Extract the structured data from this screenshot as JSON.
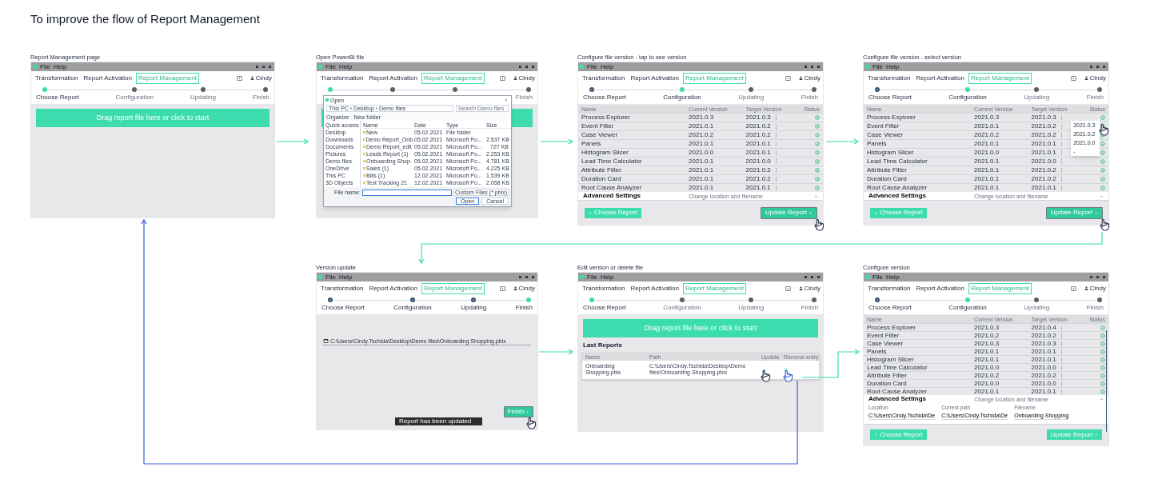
{
  "heading": "To improve the flow of Report Management",
  "screens": [
    {
      "label": "Report Management page",
      "kind": "upload",
      "menu": [
        "File",
        "Help"
      ],
      "tabs": [
        {
          "label": "Transformation",
          "selected": false
        },
        {
          "label": "Report Activation",
          "selected": false
        },
        {
          "label": "Report Management",
          "selected": true
        }
      ],
      "user": "Cindy",
      "steps": [
        {
          "label": "Choose Report",
          "done": false,
          "current": true
        },
        {
          "label": "Configuration",
          "done": false,
          "current": false
        },
        {
          "label": "Updating",
          "done": false,
          "current": false
        },
        {
          "label": "Finish",
          "done": false,
          "current": false
        }
      ],
      "drop_label": "Drag report file here or click to start"
    },
    {
      "label": "Open PowerBI file",
      "kind": "dialog",
      "menu": [
        "File",
        "Help"
      ],
      "tabs": [
        {
          "label": "Transformation",
          "selected": false
        },
        {
          "label": "Report Activation",
          "selected": false
        },
        {
          "label": "Report Management",
          "selected": true
        }
      ],
      "user": "Cindy",
      "steps": [
        {
          "done": false,
          "current": true
        },
        {
          "done": false,
          "current": false
        },
        {
          "done": false,
          "current": false
        },
        {
          "label": "Finish",
          "done": false,
          "current": false
        }
      ],
      "dialog": {
        "title": "Open",
        "address": "This PC › Desktop › Demo files",
        "search": "Search Demo files",
        "organize": "Organize",
        "new_folder": "New folder",
        "places": [
          "Quick access",
          "Desktop",
          "Downloads",
          "Documents",
          "Pictures",
          "Demo files",
          "OneDrive",
          "This PC",
          "3D Objects"
        ],
        "columns": [
          "Name",
          "Date",
          "Type",
          "Size"
        ],
        "files": [
          {
            "name": "New",
            "date": "05.02.2021",
            "type": "File folder"
          },
          {
            "name": "Demo Report_Onb.",
            "date": "05.02.2021",
            "type": "Microsoft Po...",
            "size": "2.537 KB"
          },
          {
            "name": "Demo Report_edit",
            "date": "05.02.2021",
            "type": "Microsoft Po...",
            "size": "727 KB"
          },
          {
            "name": "Leads Report (1)",
            "date": "05.02.2021",
            "type": "Microsoft Po...",
            "size": "2.253 KB"
          },
          {
            "name": "Onboarding Shop.",
            "date": "05.02.2021",
            "type": "Microsoft Po...",
            "size": "4.781 KB"
          },
          {
            "name": "Sales (1)",
            "date": "05.02.2021",
            "type": "Microsoft Po...",
            "size": "4.225 KB"
          },
          {
            "name": "Bills (1)",
            "date": "12.02.2021",
            "type": "Microsoft Po...",
            "size": "1.539 KB"
          },
          {
            "name": "Test Tracking 21",
            "date": "12.02.2021",
            "type": "Microsoft Po...",
            "size": "2.058 KB"
          }
        ],
        "file_name_label": "File name:",
        "file_type": "Custom Files (*.pbix)",
        "open_button": "Open",
        "cancel_button": "Cancel"
      }
    },
    {
      "label": "Configure file version - tap to see version",
      "kind": "config",
      "menu": [
        "File",
        "Help"
      ],
      "tabs": [
        {
          "label": "Transformation",
          "selected": false
        },
        {
          "label": "Report Activation",
          "selected": false
        },
        {
          "label": "Report Management",
          "selected": true
        }
      ],
      "user": "Cindy",
      "steps": [
        {
          "label": "Choose Report",
          "done": true,
          "current": false
        },
        {
          "label": "Configuration",
          "done": false,
          "current": true
        },
        {
          "label": "Updating",
          "done": false,
          "current": false
        },
        {
          "label": "Finish",
          "done": false,
          "current": false
        }
      ],
      "columns": [
        "Name",
        "Current Version",
        "Target Version",
        "Status"
      ],
      "rows": [
        {
          "name": "Process Explorer",
          "current": "2021.0.3",
          "target": "2021.0.3"
        },
        {
          "name": "Event Filter",
          "current": "2021.0.1",
          "target": "2021.0.2"
        },
        {
          "name": "Case Viewer",
          "current": "2021.0.2",
          "target": "2021.0.2"
        },
        {
          "name": "Panels",
          "current": "2021.0.1",
          "target": "2021.0.1"
        },
        {
          "name": "Histogram Slicer",
          "current": "2021.0.0",
          "target": "2021.0.1"
        },
        {
          "name": "Lead Time Calculator",
          "current": "2021.0.1",
          "target": "2021.0.0"
        },
        {
          "name": "Attribute Filter",
          "current": "2021.0.1",
          "target": "2021.0.2"
        },
        {
          "name": "Duration Card",
          "current": "2021.0.1",
          "target": "2021.0.2"
        },
        {
          "name": "Root Cause Analyzer",
          "current": "2021.0.1",
          "target": "2021.0.1"
        }
      ],
      "advanced": {
        "title": "Advanced Settings",
        "hint": "Change location and filename",
        "expanded": false
      },
      "back_button": "Choose Report",
      "next_button": {
        "label": "Update Report",
        "tapped": true
      }
    },
    {
      "label": "Configure file version - select version",
      "kind": "config",
      "menu": [
        "File",
        "Help"
      ],
      "tabs": [
        {
          "label": "Transformation",
          "selected": false
        },
        {
          "label": "Report Activation",
          "selected": false
        },
        {
          "label": "Report Management",
          "selected": true
        }
      ],
      "user": "Cindy",
      "steps": [
        {
          "label": "Choose Report",
          "done": true,
          "current": false
        },
        {
          "label": "Configuration",
          "done": false,
          "current": true
        },
        {
          "label": "Updating",
          "done": false,
          "current": false
        },
        {
          "label": "Finish",
          "done": false,
          "current": false
        }
      ],
      "columns": [
        "Name",
        "Current Version",
        "Target Version",
        "Status"
      ],
      "rows": [
        {
          "name": "Process Explorer",
          "current": "2021.0.3",
          "target": "2021.0.3",
          "menu": [
            {
              "label": "2021.0.3",
              "tapped": true
            },
            {
              "label": "2021.0.2",
              "tapped": false
            },
            {
              "label": "2021.0.0",
              "tapped": false
            },
            {
              "label": "-",
              "tapped": false
            }
          ]
        },
        {
          "name": "Event Filter",
          "current": "2021.0.1",
          "target": "2021.0.2"
        },
        {
          "name": "Case Viewer",
          "current": "2021.0.2",
          "target": "2021.0.2"
        },
        {
          "name": "Panels",
          "current": "2021.0.1",
          "target": "2021.0.1"
        },
        {
          "name": "Histogram Slicer",
          "current": "2021.0.0",
          "target": "2021.0.1"
        },
        {
          "name": "Lead Time Calculator",
          "current": "2021.0.1",
          "target": "2021.0.0"
        },
        {
          "name": "Attribute Filter",
          "current": "2021.0.1",
          "target": "2021.0.2"
        },
        {
          "name": "Duration Card",
          "current": "2021.0.1",
          "target": "2021.0.2"
        },
        {
          "name": "Root Cause Analyzer",
          "current": "2021.0.1",
          "target": "2021.0.1"
        }
      ],
      "advanced": {
        "title": "Advanced Settings",
        "hint": "Change location and filename",
        "expanded": false
      },
      "back_button": "Choose Report",
      "next_button": {
        "label": "Update Report",
        "tapped": true
      }
    },
    {
      "label": "Version update",
      "kind": "finish",
      "menu": [
        "File",
        "Help"
      ],
      "tabs": [
        {
          "label": "Transformation",
          "selected": false
        },
        {
          "label": "Report Activation",
          "selected": false
        },
        {
          "label": "Report Management",
          "selected": true
        }
      ],
      "user": "Cindy",
      "steps": [
        {
          "label": "Choose Report",
          "done": true,
          "current": false
        },
        {
          "label": "Configuration",
          "done": true,
          "current": false
        },
        {
          "label": "Updating",
          "done": true,
          "current": false
        },
        {
          "label": "Finish",
          "done": false,
          "current": true
        }
      ],
      "path": "C:\\Users\\Cindy.Tschida\\Desktop\\Demo files\\Onboarding Shopping.pbix",
      "toast": "Report has been updated",
      "finish_button": {
        "label": "Finish",
        "tapped": true
      }
    },
    {
      "label": "Edit version or delete file",
      "kind": "reports",
      "menu": [
        "File",
        "Help"
      ],
      "tabs": [
        {
          "label": "Transformation",
          "selected": false
        },
        {
          "label": "Report Activation",
          "selected": false
        },
        {
          "label": "Report Management",
          "selected": true
        }
      ],
      "user": "Cindy",
      "steps": [
        {
          "label": "Choose Report",
          "done": false,
          "current": true
        },
        {
          "label": "Configuration",
          "done": false,
          "current": false
        },
        {
          "label": "Updating",
          "done": false,
          "current": false
        },
        {
          "label": "Finish",
          "done": false,
          "current": false
        }
      ],
      "drop_label": "Drag report file here or click to start",
      "last_reports": {
        "title": "Last Reports",
        "columns": [
          "Name",
          "Path",
          "Update",
          "Remove entry"
        ],
        "rows": [
          {
            "name": "Onboarding Shopping.pbix",
            "path": "C:\\Users\\Cindy.Tschida\\Desktop\\Demo files\\Onboarding Shopping.pbix"
          }
        ]
      }
    },
    {
      "label": "Configure version",
      "kind": "config",
      "menu": [
        "File",
        "Help"
      ],
      "tabs": [
        {
          "label": "Transformation",
          "selected": false
        },
        {
          "label": "Report Activation",
          "selected": false
        },
        {
          "label": "Report Management",
          "selected": true
        }
      ],
      "user": "Cindy",
      "steps": [
        {
          "label": "Choose Report",
          "done": true,
          "current": false
        },
        {
          "label": "Configuration",
          "done": false,
          "current": true
        },
        {
          "label": "Updating",
          "done": false,
          "current": false
        },
        {
          "label": "Finish",
          "done": false,
          "current": false
        }
      ],
      "columns": [
        "Name",
        "Current Version",
        "Target Version",
        "Status"
      ],
      "rows": [
        {
          "name": "Process Explorer",
          "current": "2021.0.3",
          "target": "2021.0.4"
        },
        {
          "name": "Event Filter",
          "current": "2021.0.2",
          "target": "2021.0.2"
        },
        {
          "name": "Case Viewer",
          "current": "2021.0.3",
          "target": "2021.0.3"
        },
        {
          "name": "Panels",
          "current": "2021.0.1",
          "target": "2021.0.1"
        },
        {
          "name": "Histogram Slicer",
          "current": "2021.0.1",
          "target": "2021.0.1"
        },
        {
          "name": "Lead Time Calculator",
          "current": "2021.0.0",
          "target": "2021.0.0"
        },
        {
          "name": "Attribute Filter",
          "current": "2021.0.2",
          "target": "2021.0.2"
        },
        {
          "name": "Duration Card",
          "current": "2021.0.0",
          "target": "2021.0.0"
        },
        {
          "name": "Root Cause Analyzer",
          "current": "2021.0.1",
          "target": "2021.0.1"
        }
      ],
      "advanced": {
        "title": "Advanced Settings",
        "hint": "Change location and filename",
        "expanded": true,
        "fields": [
          {
            "label": "Location",
            "value": "C:\\Users\\Cindy.Tschida\\De"
          },
          {
            "label": "Current path",
            "value": "C:\\Users\\Cindy.Tschida\\De"
          },
          {
            "label": "Filename",
            "value": "Onboarding Shopping"
          }
        ]
      },
      "back_button": "Choose Report",
      "next_button": {
        "label": "Update Report",
        "tapped": false
      }
    }
  ]
}
